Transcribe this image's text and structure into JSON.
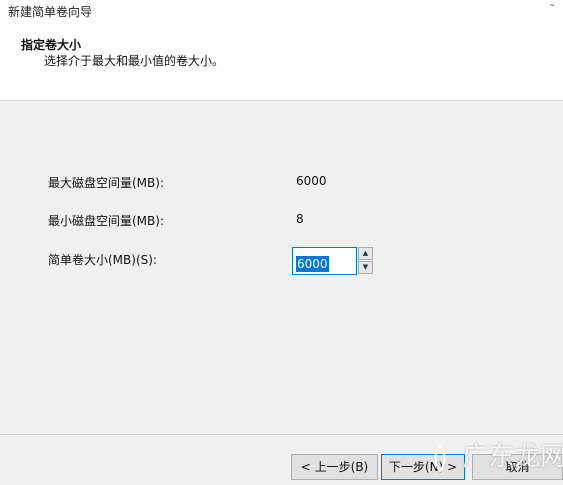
{
  "window": {
    "title": "新建简单卷向导",
    "close_glyph": "˜"
  },
  "header": {
    "title": "指定卷大小",
    "subtitle": "选择介于最大和最小值的卷大小。"
  },
  "form": {
    "max_label": "最大磁盘空间量(MB):",
    "max_value": "6000",
    "min_label": "最小磁盘空间量(MB):",
    "min_value": "8",
    "size_label": "简单卷大小(MB)(S):",
    "size_value": "6000",
    "spin_up": "▲",
    "spin_down": "▼"
  },
  "footer": {
    "back_label": "< 上一步(B)",
    "next_label": "下一步(N) >",
    "cancel_label": "取消"
  },
  "watermark": {
    "text": "广东龙网"
  },
  "colors": {
    "accent": "#0078d7",
    "background": "#f0f0f0",
    "header_bg": "#ffffff"
  }
}
